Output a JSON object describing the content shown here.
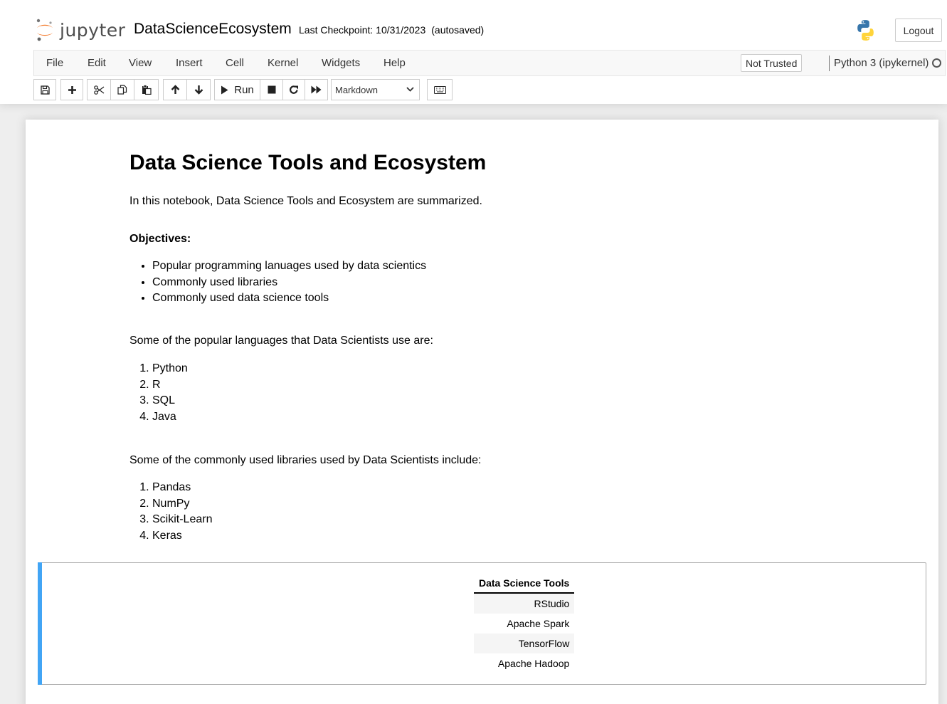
{
  "header": {
    "logo_text": "jupyter",
    "notebook_name": "DataScienceEcosystem",
    "checkpoint_text": "Last Checkpoint: 10/31/2023",
    "autosaved_text": "(autosaved)",
    "logout_label": "Logout"
  },
  "menubar": {
    "items": [
      "File",
      "Edit",
      "View",
      "Insert",
      "Cell",
      "Kernel",
      "Widgets",
      "Help"
    ],
    "trust_label": "Not Trusted",
    "kernel_name": "Python 3 (ipykernel)"
  },
  "toolbar": {
    "run_label": "Run",
    "cell_type": "Markdown"
  },
  "notebook": {
    "title": "Data Science Tools and Ecosystem",
    "intro": "In this notebook, Data Science Tools and Ecosystem are summarized.",
    "objectives_title": "Objectives:",
    "objectives": [
      "Popular programming lanuages used by data scientics",
      "Commonly used libraries",
      "Commonly used data science tools"
    ],
    "languages_intro": "Some of the popular languages that Data Scientists use are:",
    "languages": [
      "Python",
      "R",
      "SQL",
      "Java"
    ],
    "libraries_intro": "Some of the commonly used libraries used by Data Scientists include:",
    "libraries": [
      "Pandas",
      "NumPy",
      "Scikit-Learn",
      "Keras"
    ],
    "tools_table": {
      "header": "Data Science Tools",
      "rows": [
        "RStudio",
        "Apache Spark",
        "TensorFlow",
        "Apache Hadoop"
      ]
    }
  },
  "colors": {
    "jupyter_orange": "#f37726",
    "selected_cell_bar": "#42a5f5"
  }
}
